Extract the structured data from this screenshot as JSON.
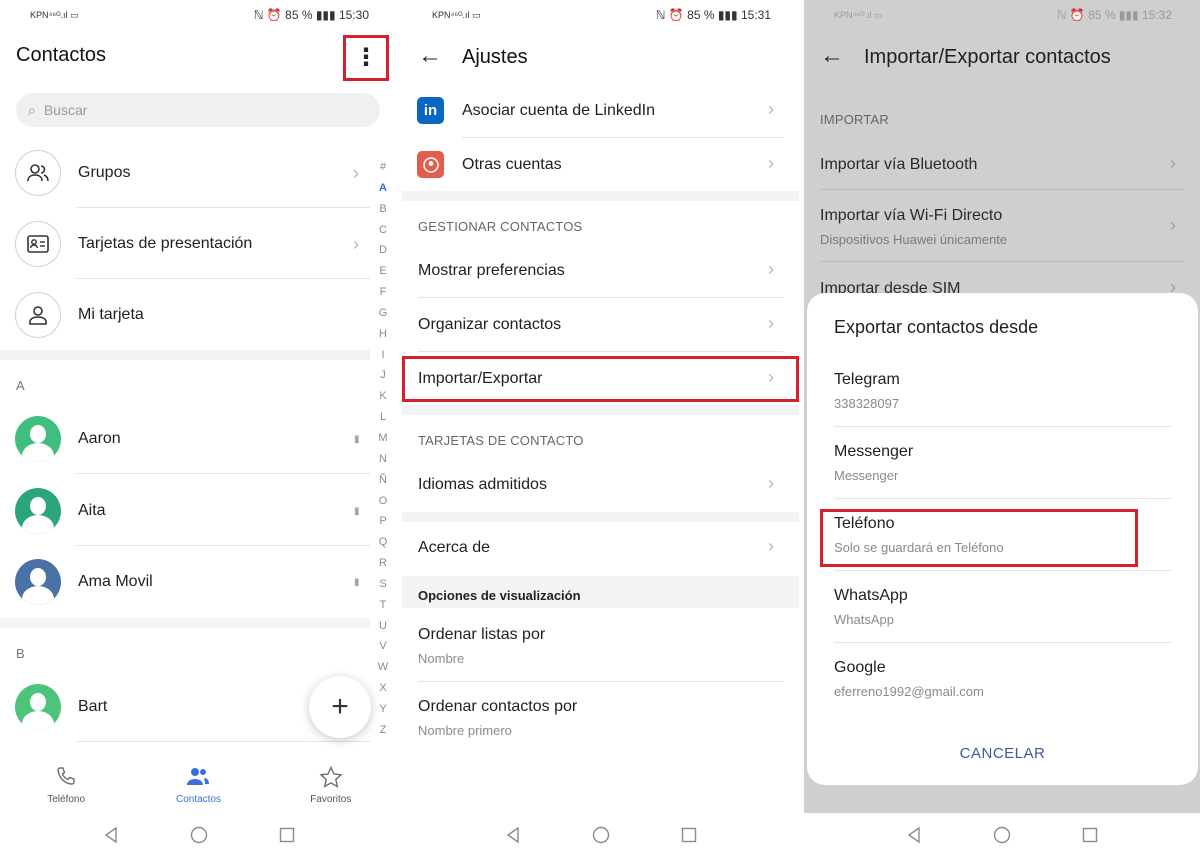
{
  "status1": {
    "carrier": "KPN⁴⁶ᴳ.ıl ▭",
    "right": "ℕ ⏰ 85 % ▮▮▮ 15:30"
  },
  "status2": {
    "carrier": "KPN⁴⁶ᴳ.ıl ▭",
    "right": "ℕ ⏰ 85 % ▮▮▮ 15:31"
  },
  "status3": {
    "carrier": "KPN⁴⁶ᴳ.ıl ▭",
    "right": "ℕ ⏰ 85 % ▮▮▮ 15:32"
  },
  "contacts": {
    "title": "Contactos",
    "search_placeholder": "Buscar",
    "menu_glyph": "⋮",
    "groups": [
      {
        "label": "Grupos",
        "icon": "people-icon"
      },
      {
        "label": "Tarjetas de presentación",
        "icon": "card-icon"
      },
      {
        "label": "Mi tarjeta",
        "icon": "person-icon"
      }
    ],
    "sections": [
      {
        "letter": "A",
        "items": [
          {
            "name": "Aaron",
            "color": "#3fbf7f"
          },
          {
            "name": "Aita",
            "color": "#2aa57e"
          },
          {
            "name": "Ama Movil",
            "color": "#4a72a8"
          }
        ]
      },
      {
        "letter": "B",
        "items": [
          {
            "name": "Bart",
            "color": "#4cc47a"
          }
        ]
      }
    ],
    "index": [
      "#",
      "A",
      "B",
      "C",
      "D",
      "E",
      "F",
      "G",
      "H",
      "I",
      "J",
      "K",
      "L",
      "M",
      "N",
      "Ñ",
      "O",
      "P",
      "Q",
      "R",
      "S",
      "T",
      "U",
      "V",
      "W",
      "X",
      "Y",
      "Z"
    ],
    "fab_glyph": "+",
    "tabs": [
      {
        "label": "Teléfono",
        "icon": "phone-icon"
      },
      {
        "label": "Contactos",
        "icon": "contacts-icon"
      },
      {
        "label": "Favoritos",
        "icon": "star-icon"
      }
    ],
    "active_color": "#3a6fd8"
  },
  "settings": {
    "title": "Ajustes",
    "accounts": [
      {
        "label": "Asociar cuenta de LinkedIn",
        "icon": "linkedin-icon",
        "color": "#0a66c2"
      },
      {
        "label": "Otras cuentas",
        "icon": "account-icon",
        "color": "#e35d4f"
      }
    ],
    "manage_header": "GESTIONAR CONTACTOS",
    "manage": [
      "Mostrar preferencias",
      "Organizar contactos",
      "Importar/Exportar"
    ],
    "cards_header": "TARJETAS DE CONTACTO",
    "cards": [
      "Idiomas admitidos"
    ],
    "about": "Acerca de",
    "display_header": "Opciones de visualización",
    "display": [
      {
        "label": "Ordenar listas por",
        "value": "Nombre"
      },
      {
        "label": "Ordenar contactos por",
        "value": "Nombre primero"
      }
    ]
  },
  "import_export": {
    "title": "Importar/Exportar contactos",
    "import_header": "IMPORTAR",
    "import_items": [
      {
        "label": "Importar vía Bluetooth",
        "sub": ""
      },
      {
        "label": "Importar vía Wi-Fi Directo",
        "sub": "Dispositivos Huawei únicamente"
      },
      {
        "label": "Importar desde SIM",
        "sub": ""
      }
    ],
    "dialog": {
      "title": "Exportar contactos desde",
      "options": [
        {
          "label": "Telegram",
          "sub": "338328097"
        },
        {
          "label": "Messenger",
          "sub": "Messenger"
        },
        {
          "label": "Teléfono",
          "sub": "Solo se guardará en Teléfono"
        },
        {
          "label": "WhatsApp",
          "sub": "WhatsApp"
        },
        {
          "label": "Google",
          "sub": "eferreno1992@gmail.com"
        }
      ],
      "cancel": "CANCELAR"
    }
  },
  "highlight_color": "#d4202a"
}
